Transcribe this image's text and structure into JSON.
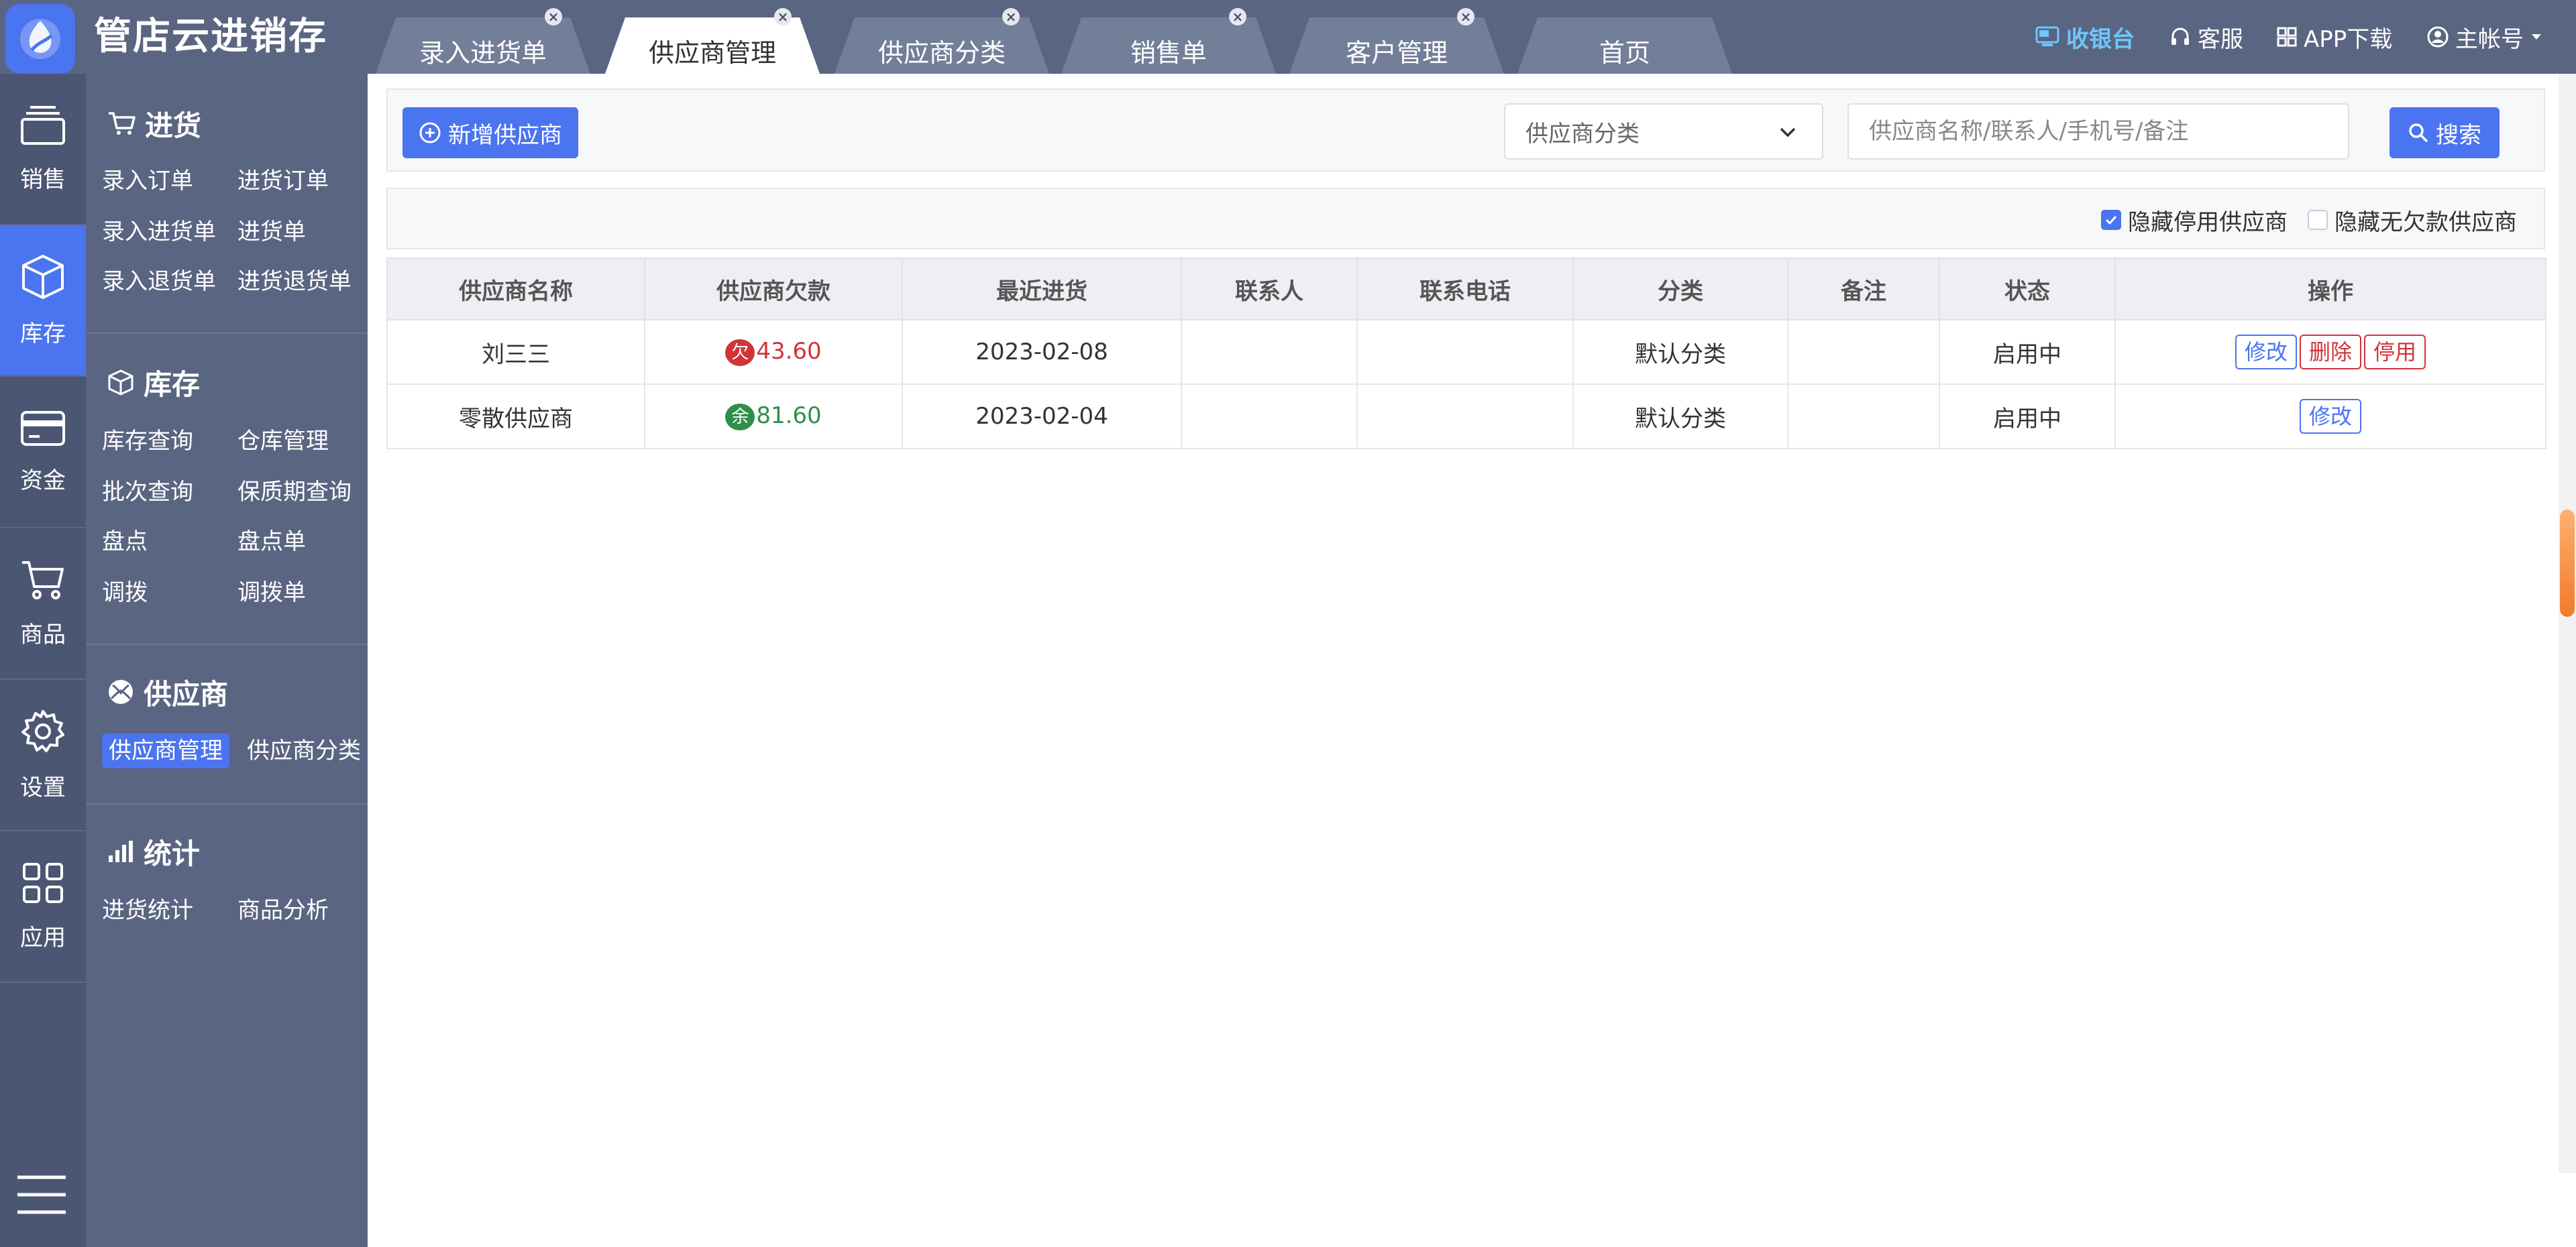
{
  "app": {
    "title": "管店云进销存"
  },
  "tabs": [
    {
      "label": "录入进货单",
      "closable": true,
      "active": false
    },
    {
      "label": "供应商管理",
      "closable": true,
      "active": true
    },
    {
      "label": "供应商分类",
      "closable": true,
      "active": false
    },
    {
      "label": "销售单",
      "closable": true,
      "active": false
    },
    {
      "label": "客户管理",
      "closable": true,
      "active": false
    },
    {
      "label": "首页",
      "closable": false,
      "active": false
    }
  ],
  "topbar": {
    "cashier": "收银台",
    "support": "客服",
    "app_download": "APP下载",
    "account": "主帐号",
    "close_glyph": "×"
  },
  "rail": [
    {
      "label": "销售",
      "icon": "layers-icon",
      "active": false
    },
    {
      "label": "库存",
      "icon": "box-icon",
      "active": true
    },
    {
      "label": "资金",
      "icon": "card-icon",
      "active": false
    },
    {
      "label": "商品",
      "icon": "cart-icon",
      "active": false
    },
    {
      "label": "设置",
      "icon": "gear-icon",
      "active": false
    },
    {
      "label": "应用",
      "icon": "grid-icon",
      "active": false
    }
  ],
  "submenu": {
    "purchase": {
      "title": "进货",
      "links": [
        "录入订单",
        "进货订单",
        "录入进货单",
        "进货单",
        "录入退货单",
        "进货退货单"
      ]
    },
    "stock": {
      "title": "库存",
      "links": [
        "库存查询",
        "仓库管理",
        "批次查询",
        "保质期查询",
        "盘点",
        "盘点单",
        "调拨",
        "调拨单"
      ]
    },
    "supplier": {
      "title": "供应商",
      "links": [
        "供应商管理",
        "供应商分类"
      ]
    },
    "stats": {
      "title": "统计",
      "links": [
        "进货统计",
        "商品分析"
      ]
    }
  },
  "toolbar": {
    "add_label": "新增供应商",
    "category_placeholder": "供应商分类",
    "search_placeholder": "供应商名称/联系人/手机号/备注",
    "search_label": "搜索"
  },
  "filters": {
    "hide_disabled": {
      "label": "隐藏停用供应商",
      "checked": true
    },
    "hide_no_debt": {
      "label": "隐藏无欠款供应商",
      "checked": false
    }
  },
  "table": {
    "headers": [
      "供应商名称",
      "供应商欠款",
      "最近进货",
      "联系人",
      "联系电话",
      "分类",
      "备注",
      "状态",
      "操作"
    ],
    "rows": [
      {
        "name": "刘三三",
        "debt_badge": "欠",
        "debt_value": "43.60",
        "debt_type": "owe",
        "last_purchase": "2023-02-08",
        "contact": "",
        "phone": "",
        "category": "默认分类",
        "note": "",
        "status": "启用中",
        "actions": [
          "修改",
          "删除",
          "停用"
        ]
      },
      {
        "name": "零散供应商",
        "debt_badge": "余",
        "debt_value": "81.60",
        "debt_type": "balance",
        "last_purchase": "2023-02-04",
        "contact": "",
        "phone": "",
        "category": "默认分类",
        "note": "",
        "status": "启用中",
        "actions": [
          "修改"
        ]
      }
    ]
  },
  "colors": {
    "accent": "#4b74f0",
    "sidebar": "#5a6582",
    "rail": "#4b5673",
    "owe_red": "#d0343a",
    "ok_green": "#2f8f4a"
  }
}
